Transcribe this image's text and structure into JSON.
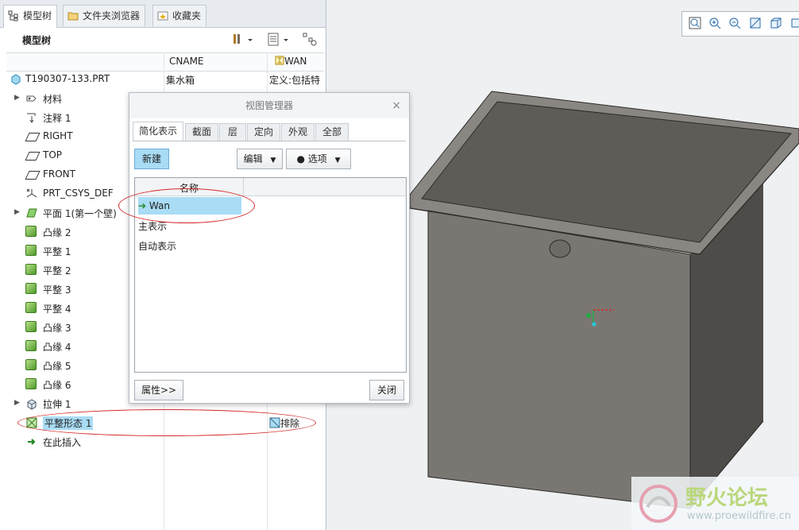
{
  "left_panel": {
    "tabs": [
      {
        "label": "模型树",
        "icon": "model-tree-icon"
      },
      {
        "label": "文件夹浏览器",
        "icon": "folder-browser-icon"
      },
      {
        "label": "收藏夹",
        "icon": "favorites-icon"
      }
    ],
    "tree_title": "模型树",
    "columns": [
      "CNAME",
      "WAN"
    ],
    "root": {
      "label": "T190307-133.PRT",
      "cname": "集水箱",
      "wan": "定义:包括特"
    },
    "items": [
      {
        "label": "材料",
        "icon": "material-icon",
        "expandable": true
      },
      {
        "label": "注释 1",
        "icon": "annotation-icon",
        "expandable": false
      },
      {
        "label": "RIGHT",
        "icon": "datum-plane-icon",
        "expandable": false
      },
      {
        "label": "TOP",
        "icon": "datum-plane-icon",
        "expandable": false
      },
      {
        "label": "FRONT",
        "icon": "datum-plane-icon",
        "expandable": false
      },
      {
        "label": "PRT_CSYS_DEF",
        "icon": "csys-icon",
        "expandable": false
      },
      {
        "label": "平面 1(第一个壁)",
        "icon": "sheetmetal-wall-icon",
        "expandable": true
      },
      {
        "label": "凸缘 2",
        "icon": "flange-icon",
        "expandable": false
      },
      {
        "label": "平整 1",
        "icon": "flat-wall-icon",
        "expandable": false
      },
      {
        "label": "平整 2",
        "icon": "flat-wall-icon",
        "expandable": false
      },
      {
        "label": "平整 3",
        "icon": "flat-wall-icon",
        "expandable": false
      },
      {
        "label": "平整 4",
        "icon": "flat-wall-icon",
        "expandable": false
      },
      {
        "label": "凸缘 3",
        "icon": "flange-icon",
        "expandable": false
      },
      {
        "label": "凸缘 4",
        "icon": "flange-icon",
        "expandable": false
      },
      {
        "label": "凸缘 5",
        "icon": "flange-icon",
        "expandable": false
      },
      {
        "label": "凸缘 6",
        "icon": "flange-icon",
        "expandable": false
      },
      {
        "label": "拉伸 1",
        "icon": "extrude-icon",
        "expandable": true
      },
      {
        "label": "平整形态 1",
        "icon": "flat-pattern-icon",
        "expandable": false,
        "wan": "排除"
      },
      {
        "label": "在此插入",
        "icon": "insert-here-arrow-icon",
        "expandable": false
      }
    ]
  },
  "dialog": {
    "title": "视图管理器",
    "close_label": "×",
    "tabs": [
      "简化表示",
      "截面",
      "层",
      "定向",
      "外观",
      "全部"
    ],
    "new_button": "新建",
    "edit_button": "编辑",
    "options_button": "选项",
    "list_header": "名称",
    "list_items": [
      "Wan",
      "主表示",
      "自动表示"
    ],
    "properties_button": "属性>>",
    "close_button": "关闭"
  },
  "viewport": {
    "toolbar": [
      "zoom-fit-icon",
      "zoom-in-icon",
      "zoom-out-icon",
      "repaint-icon",
      "view-cube-icon"
    ]
  },
  "watermark": {
    "title": "野火论坛",
    "url": "www.proewildfire.cn"
  },
  "colors": {
    "selection": "#a9dcf5",
    "highlight_oval": "#d42a2a",
    "accent_green": "#4f9a2a"
  }
}
